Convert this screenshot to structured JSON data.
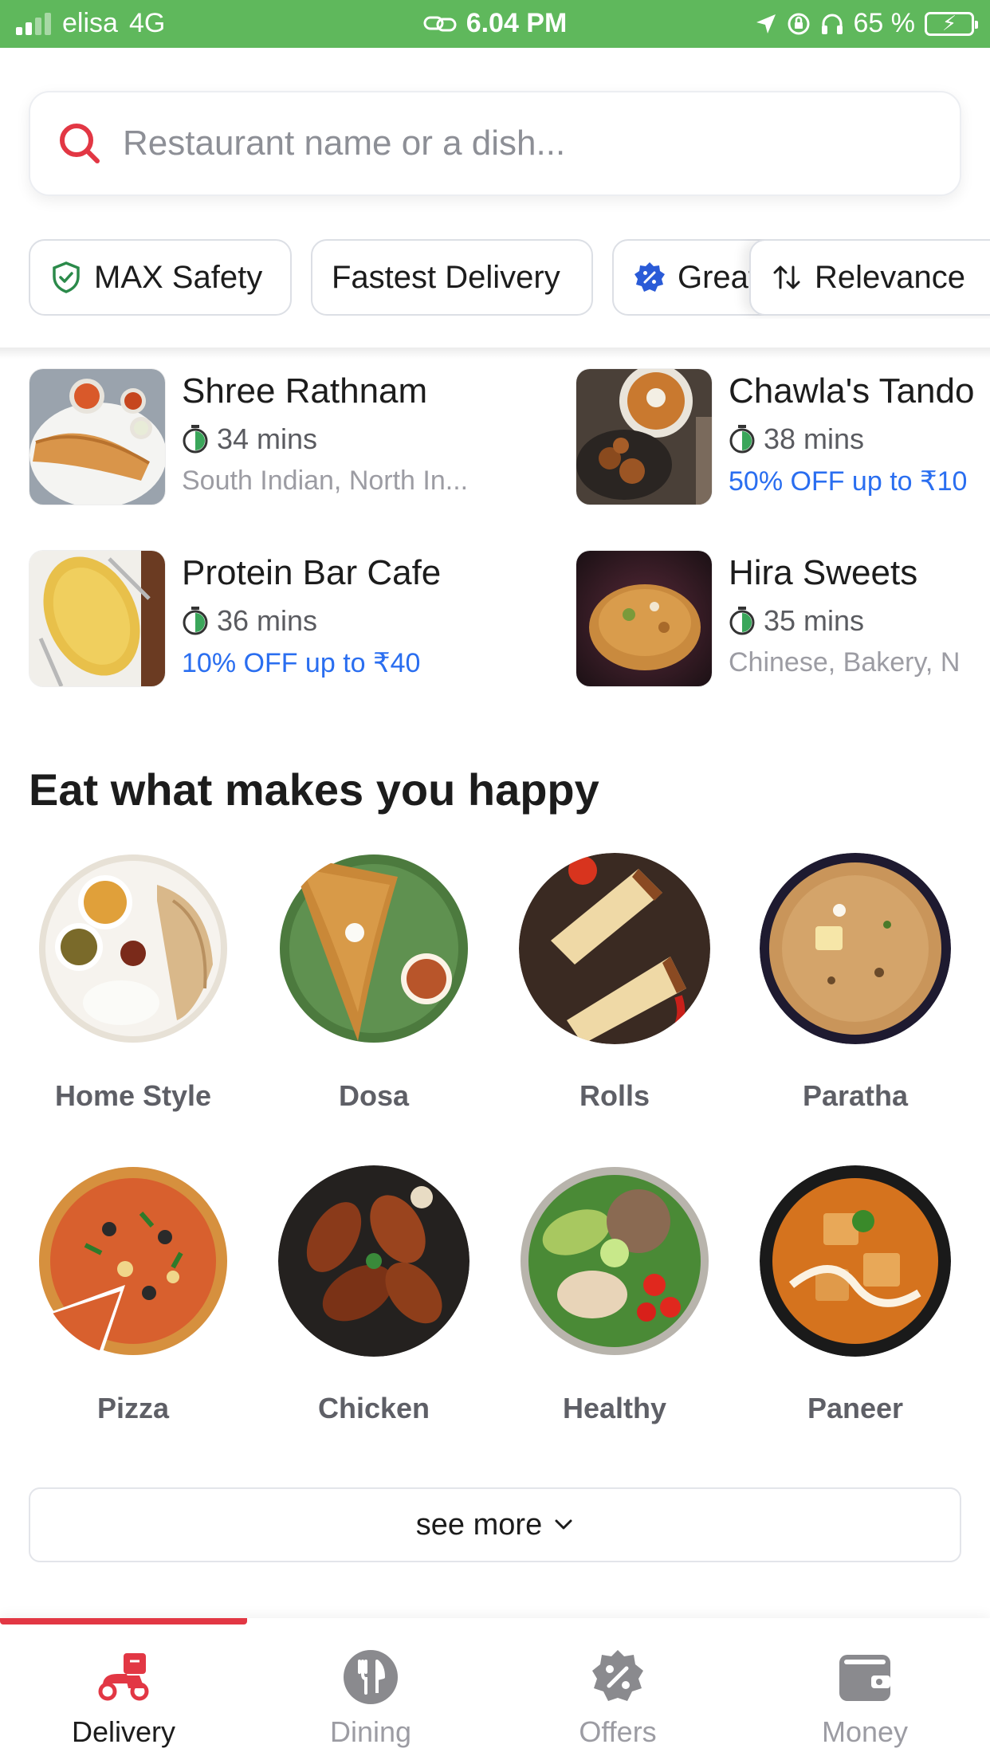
{
  "status_bar": {
    "carrier": "elisa",
    "network": "4G",
    "time": "6.04 PM",
    "battery": "65 %"
  },
  "search": {
    "placeholder": "Restaurant name or a dish..."
  },
  "filters": [
    {
      "label": "MAX Safety",
      "icon": "shield-check-icon"
    },
    {
      "label": "Fastest Delivery"
    },
    {
      "label": "Great",
      "icon": "offer-badge-icon"
    },
    {
      "label": "Relevance",
      "icon": "sort-icon"
    }
  ],
  "restaurants": [
    {
      "name": "Shree Rathnam",
      "time": "34 mins",
      "meta": "South Indian, North In...",
      "meta_type": "cuisine"
    },
    {
      "name": "Chawla's Tando",
      "time": "38 mins",
      "meta": "50% OFF up to ₹10",
      "meta_type": "offer"
    },
    {
      "name": "Protein Bar Cafe",
      "time": "36 mins",
      "meta": "10% OFF up to ₹40",
      "meta_type": "offer"
    },
    {
      "name": "Hira Sweets",
      "time": "35 mins",
      "meta": "Chinese, Bakery, N",
      "meta_type": "cuisine"
    }
  ],
  "categories_section": {
    "title": "Eat what makes you happy",
    "items": [
      {
        "label": "Home Style"
      },
      {
        "label": "Dosa"
      },
      {
        "label": "Rolls"
      },
      {
        "label": "Paratha"
      },
      {
        "label": "Pizza"
      },
      {
        "label": "Chicken"
      },
      {
        "label": "Healthy"
      },
      {
        "label": "Paneer"
      }
    ],
    "see_more": "see more"
  },
  "bottom_nav": {
    "active": "Delivery",
    "items": [
      {
        "label": "Delivery",
        "icon": "scooter-icon"
      },
      {
        "label": "Dining",
        "icon": "cutlery-icon"
      },
      {
        "label": "Offers",
        "icon": "percent-badge-icon"
      },
      {
        "label": "Money",
        "icon": "wallet-icon"
      }
    ]
  },
  "colors": {
    "brand_red": "#e23744",
    "offer_blue": "#2a6ef0",
    "status_bar_green": "#5fb85c",
    "safety_green": "#2b8a4a"
  }
}
